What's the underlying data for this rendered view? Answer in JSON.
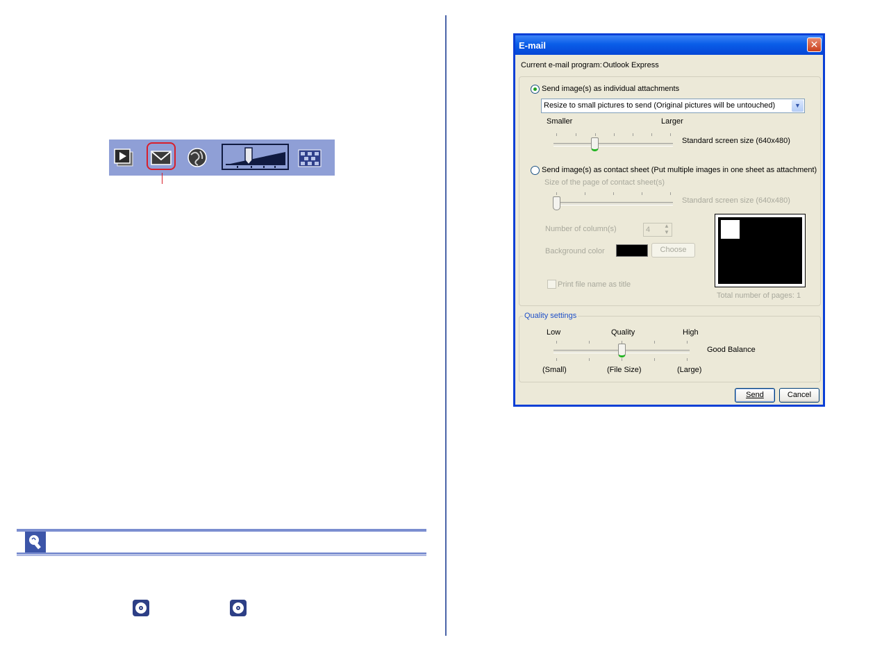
{
  "colors": {
    "accent": "#0a5de8",
    "highlight": "#d81e2a",
    "toolbar": "#8f9fd6"
  },
  "toolbar": {
    "icons": [
      "slideshow-icon",
      "email-icon",
      "web-icon",
      "zoom-slider",
      "grid-icon"
    ]
  },
  "dialog": {
    "title": "E-mail",
    "close_glyph": "✕",
    "current_program_label": "Current e-mail program:",
    "current_program_value": "Outlook Express",
    "individual": {
      "label": "Send image(s) as individual attachments",
      "selected": true,
      "resize_option": "Resize to small pictures to send (Original pictures will be untouched)",
      "smaller_label": "Smaller",
      "larger_label": "Larger",
      "size_value": "Standard screen size (640x480)"
    },
    "contact_sheet": {
      "label": "Send image(s) as contact sheet (Put multiple images in one sheet as attachment)",
      "selected": false,
      "page_size_label": "Size of the page of contact sheet(s)",
      "size_value": "Standard screen size (640x480)",
      "columns_label": "Number of column(s)",
      "columns_value": "4",
      "bg_color_label": "Background color",
      "bg_color": "#000000",
      "choose_label": "Choose",
      "print_filename_label": "Print file name as title",
      "total_pages": "Total number of pages: 1"
    },
    "quality": {
      "group_label": "Quality settings",
      "low": "Low",
      "quality": "Quality",
      "high": "High",
      "value_label": "Good Balance",
      "small": "(Small)",
      "file_size": "(File Size)",
      "large": "(Large)"
    },
    "send_label": "Send",
    "cancel_label": "Cancel"
  }
}
